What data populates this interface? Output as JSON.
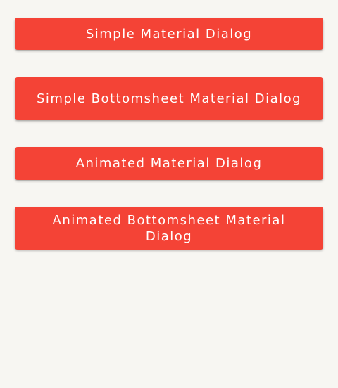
{
  "buttons": {
    "simple_dialog": "Simple Material Dialog",
    "simple_bottomsheet_dialog": "Simple Bottomsheet Material Dialog",
    "animated_dialog": "Animated Material Dialog",
    "animated_bottomsheet_dialog": "Animated Bottomsheet Material Dialog"
  },
  "colors": {
    "background": "#f7f6f2",
    "button": "#f44336",
    "button_text": "#ffffff"
  }
}
